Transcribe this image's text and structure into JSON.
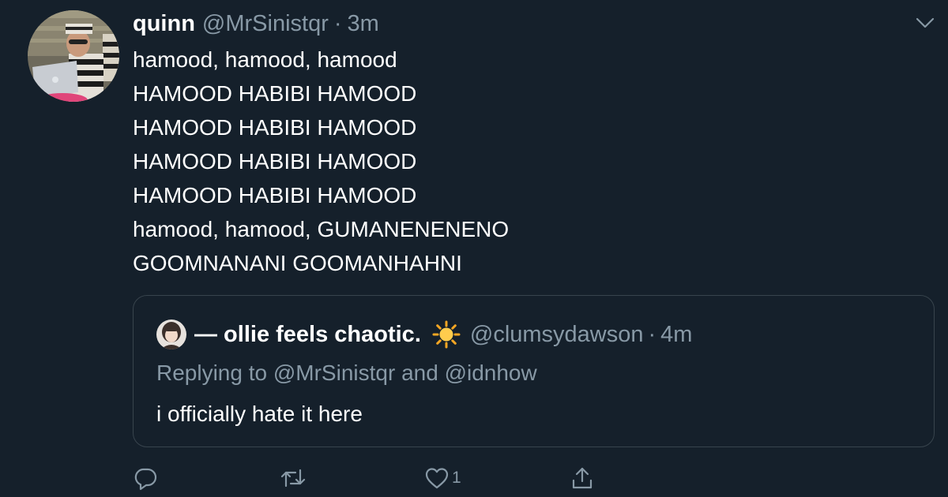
{
  "tweet": {
    "display_name": "quinn",
    "handle": "@MrSinistqr",
    "separator": "·",
    "time": "3m",
    "lines": [
      "hamood, hamood, hamood",
      "HAMOOD HABIBI HAMOOD",
      "HAMOOD HABIBI HAMOOD",
      "HAMOOD HABIBI HAMOOD",
      "HAMOOD HABIBI HAMOOD",
      "hamood, hamood, GUMANENENENO",
      "GOOMNANANI GOOMANHAHNI"
    ],
    "avatar_icon": "user-photo-avatar",
    "menu_icon": "chevron-down-icon"
  },
  "quoted_tweet": {
    "display_name": "— ollie feels chaotic.",
    "emoji_icon": "sun-emoji-icon",
    "handle": "@clumsydawson",
    "separator": "·",
    "time": "4m",
    "replying_to": "Replying to @MrSinistqr and @idnhow",
    "text": "i officially hate it here"
  },
  "actions": {
    "reply_icon": "reply-icon",
    "retweet_icon": "retweet-icon",
    "like_icon": "heart-icon",
    "like_count": "1",
    "share_icon": "share-icon"
  },
  "colors": {
    "background": "#15202b",
    "primary_text": "#ffffff",
    "secondary_text": "#8899a6",
    "border": "#38444d"
  }
}
